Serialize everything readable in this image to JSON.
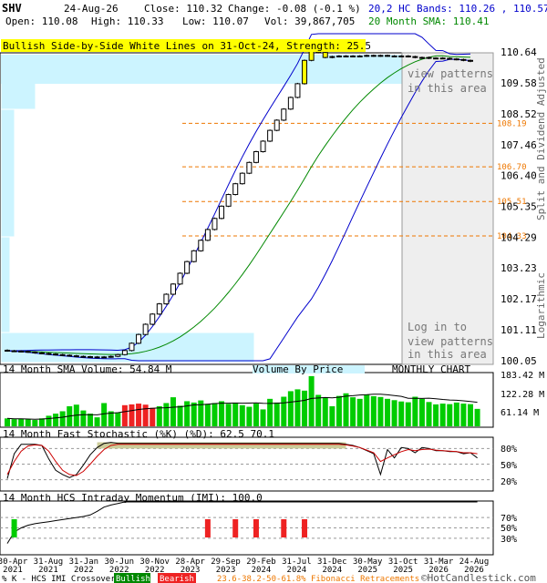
{
  "header": {
    "symbol": "SHV",
    "date": "24-Aug-26",
    "close": "Close: 110.32",
    "change": "Change: -0.08 (-0.1 %)",
    "open": "Open: 110.08",
    "high": "High: 110.33",
    "low": "Low: 110.07",
    "vol": "Vol: 39,867,705",
    "bands": "20,2 HC Bands: 110.26 , 110.57",
    "sma": "20 Month SMA: 110.41"
  },
  "pattern_banner": "Bullish Side-by-Side White Lines on 31-Oct-24, Strength: 25.5",
  "login_text": [
    "view patterns",
    "in this area",
    "Log in to",
    "view patterns",
    "in this area"
  ],
  "price_axis_title": "Split and Dividend Adjusted",
  "log_label": "Logarithmic",
  "volume_panel": {
    "title": "14 Month SMA Volume: 54.84 M",
    "vbp_label": "Volume By Price",
    "chart_label": "MONTHLY CHART",
    "ticks": [
      "183.42 M",
      "122.28 M",
      "61.14 M"
    ]
  },
  "stoch_panel": {
    "title": "14 Month Fast Stochastic (%K) (%D): 62.5   70.1",
    "ticks": [
      "80%",
      "50%",
      "20%"
    ]
  },
  "imi_panel": {
    "title": "14 Month HCS Intraday Momentum (IMI): 100.0",
    "ticks": [
      "70%",
      "50%",
      "30%"
    ]
  },
  "footer": {
    "legend": "% K - HCS IMI Crossover:",
    "bullish": "Bullish",
    "bearish": "Bearish",
    "fib": "23.6-38.2-50-61.8% Fibonacci Retracements",
    "copyright": "©HotCandlestick.com"
  },
  "colors": {
    "up": "#ffffff",
    "down": "#000000",
    "band": "#0000cc",
    "sma": "#008800",
    "vol_up": "#00cc00",
    "vol_down": "#ee2222",
    "fib": "#ee7700",
    "vbp": "#ccf4ff",
    "banner": "#ffff00",
    "stoch_fill": "#cccc99"
  },
  "chart_data": {
    "type": "candlestick",
    "price_ticks": [
      110.64,
      109.58,
      108.52,
      107.46,
      106.4,
      105.35,
      104.29,
      103.23,
      102.17,
      101.11,
      100.05
    ],
    "fib_levels": [
      108.19,
      106.7,
      105.51,
      104.33
    ],
    "x_labels": [
      "30-Apr\n2021",
      "31-Aug\n2021",
      "31-Jan\n2022",
      "30-Jun\n2022",
      "30-Nov\n2022",
      "28-Apr\n2023",
      "29-Sep\n2023",
      "29-Feb\n2024",
      "31-Jul\n2024",
      "31-Dec\n2024",
      "30-May\n2025",
      "31-Oct\n2025",
      "31-Mar\n2026",
      "24-Aug\n2026"
    ],
    "closes": [
      100.39,
      100.38,
      100.37,
      100.35,
      100.32,
      100.3,
      100.28,
      100.26,
      100.24,
      100.22,
      100.2,
      100.19,
      100.18,
      100.18,
      100.18,
      100.2,
      100.26,
      100.4,
      100.65,
      100.95,
      101.3,
      101.65,
      102.0,
      102.33,
      102.68,
      103.05,
      103.45,
      103.82,
      104.18,
      104.55,
      104.93,
      105.35,
      105.75,
      106.12,
      106.48,
      106.85,
      107.22,
      107.58,
      107.95,
      108.3,
      108.68,
      109.08,
      109.55,
      110.35,
      110.85,
      110.62,
      110.45,
      110.48,
      110.5,
      110.5,
      110.5,
      110.5,
      110.52,
      110.5,
      110.52,
      110.5,
      110.5,
      110.5,
      110.48,
      110.45,
      110.45,
      110.42,
      110.43,
      110.42,
      110.4,
      110.38,
      110.35,
      110.32
    ],
    "volume": [
      30,
      27,
      28,
      26,
      24,
      30,
      40,
      48,
      57,
      76,
      82,
      60,
      48,
      34,
      88,
      57,
      52,
      80,
      83,
      86,
      82,
      70,
      76,
      88,
      110,
      78,
      95,
      90,
      98,
      85,
      88,
      95,
      85,
      90,
      80,
      74,
      86,
      64,
      104,
      90,
      112,
      133,
      140,
      135,
      190,
      119,
      107,
      76,
      115,
      125,
      110,
      104,
      119,
      114,
      111,
      104,
      99,
      94,
      91,
      112,
      104,
      92,
      83,
      86,
      84,
      90,
      86,
      84,
      66
    ],
    "vol_down_idx": [
      17,
      18,
      19,
      20,
      21
    ],
    "stoch_k": [
      22,
      70,
      88,
      88,
      88,
      86,
      60,
      38,
      30,
      24,
      30,
      48,
      68,
      82,
      90,
      92,
      90,
      90,
      90,
      90,
      90,
      90,
      90,
      90,
      90,
      90,
      90,
      90,
      90,
      90,
      90,
      90,
      90,
      90,
      90,
      90,
      90,
      90,
      90,
      90,
      90,
      90,
      90,
      90,
      90,
      90,
      90,
      90,
      90,
      88,
      86,
      82,
      76,
      70,
      30,
      78,
      62,
      82,
      80,
      72,
      82,
      80,
      76,
      76,
      74,
      74,
      70,
      72,
      62
    ],
    "stoch_d": [
      30,
      55,
      75,
      85,
      87,
      86,
      75,
      55,
      38,
      30,
      28,
      36,
      50,
      65,
      78,
      86,
      88,
      88,
      88,
      88,
      88,
      88,
      88,
      88,
      88,
      88,
      88,
      88,
      88,
      88,
      88,
      88,
      88,
      88,
      88,
      88,
      88,
      88,
      88,
      88,
      88,
      88,
      88,
      88,
      88,
      88,
      88,
      88,
      88,
      87,
      85,
      82,
      77,
      72,
      55,
      62,
      68,
      74,
      78,
      76,
      78,
      79,
      77,
      76,
      75,
      74,
      72,
      72,
      70
    ],
    "imi": [
      20,
      42,
      50,
      55,
      58,
      60,
      62,
      64,
      66,
      68,
      70,
      72,
      75,
      82,
      90,
      94,
      97,
      100,
      100,
      100,
      100,
      100,
      100,
      100,
      100,
      100,
      100,
      100,
      100,
      100,
      100,
      100,
      100,
      100,
      100,
      100,
      100,
      100,
      100,
      100,
      100,
      100,
      100,
      100,
      100,
      100,
      100,
      100,
      100,
      100,
      100,
      100,
      100,
      100,
      100,
      100,
      100,
      100,
      100,
      100,
      100,
      100,
      100,
      100,
      100,
      100,
      100,
      100,
      100
    ],
    "bullish_cross_idx": [
      1
    ],
    "bearish_cross_idx": [
      29,
      33,
      36,
      40,
      43
    ]
  }
}
